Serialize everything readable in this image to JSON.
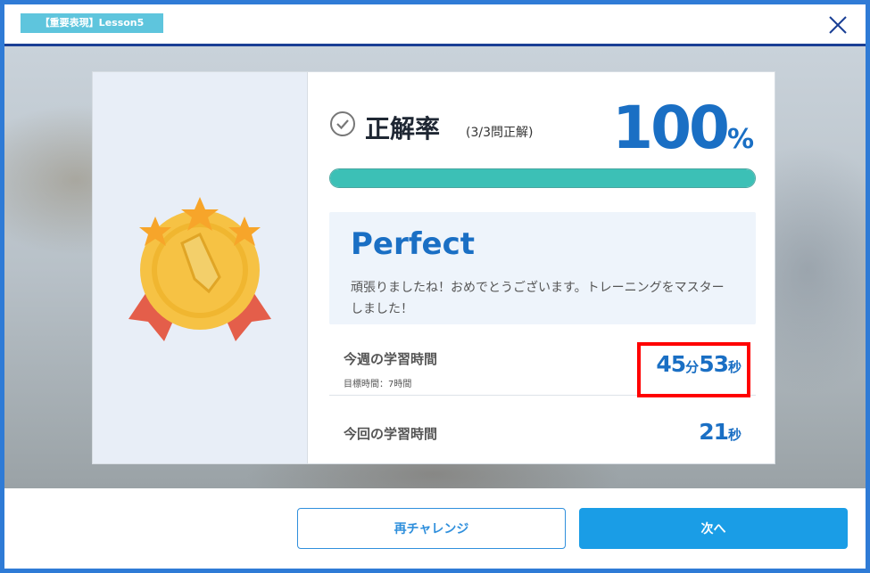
{
  "header": {
    "lesson_tag": "【重要表現】Lesson5",
    "close_icon": "close-icon"
  },
  "result": {
    "title": "正解率",
    "subtitle": "(3/3問正解)",
    "score_number": "100",
    "score_unit": "%",
    "progress_fraction": 1.0
  },
  "perfect": {
    "title": "Perfect",
    "message": "頑張りましたね！おめでとうございます。トレーニングをマスターしました！"
  },
  "weekly": {
    "label": "今週の学習時間",
    "goal": "目標時間：7時間",
    "minutes": "45",
    "minutes_unit": "分",
    "seconds": "53",
    "seconds_unit": "秒"
  },
  "current": {
    "label": "今回の学習時間",
    "seconds": "21",
    "seconds_unit": "秒"
  },
  "buttons": {
    "retry": "再チャレンジ",
    "next": "次へ"
  },
  "colors": {
    "accent_blue": "#1a6fc4",
    "progress_teal": "#3cc0b6",
    "next_button": "#1a9de6",
    "highlight_red": "#ff0000"
  },
  "icons": [
    "close-icon",
    "check-circle-icon",
    "gold-medal-icon"
  ]
}
